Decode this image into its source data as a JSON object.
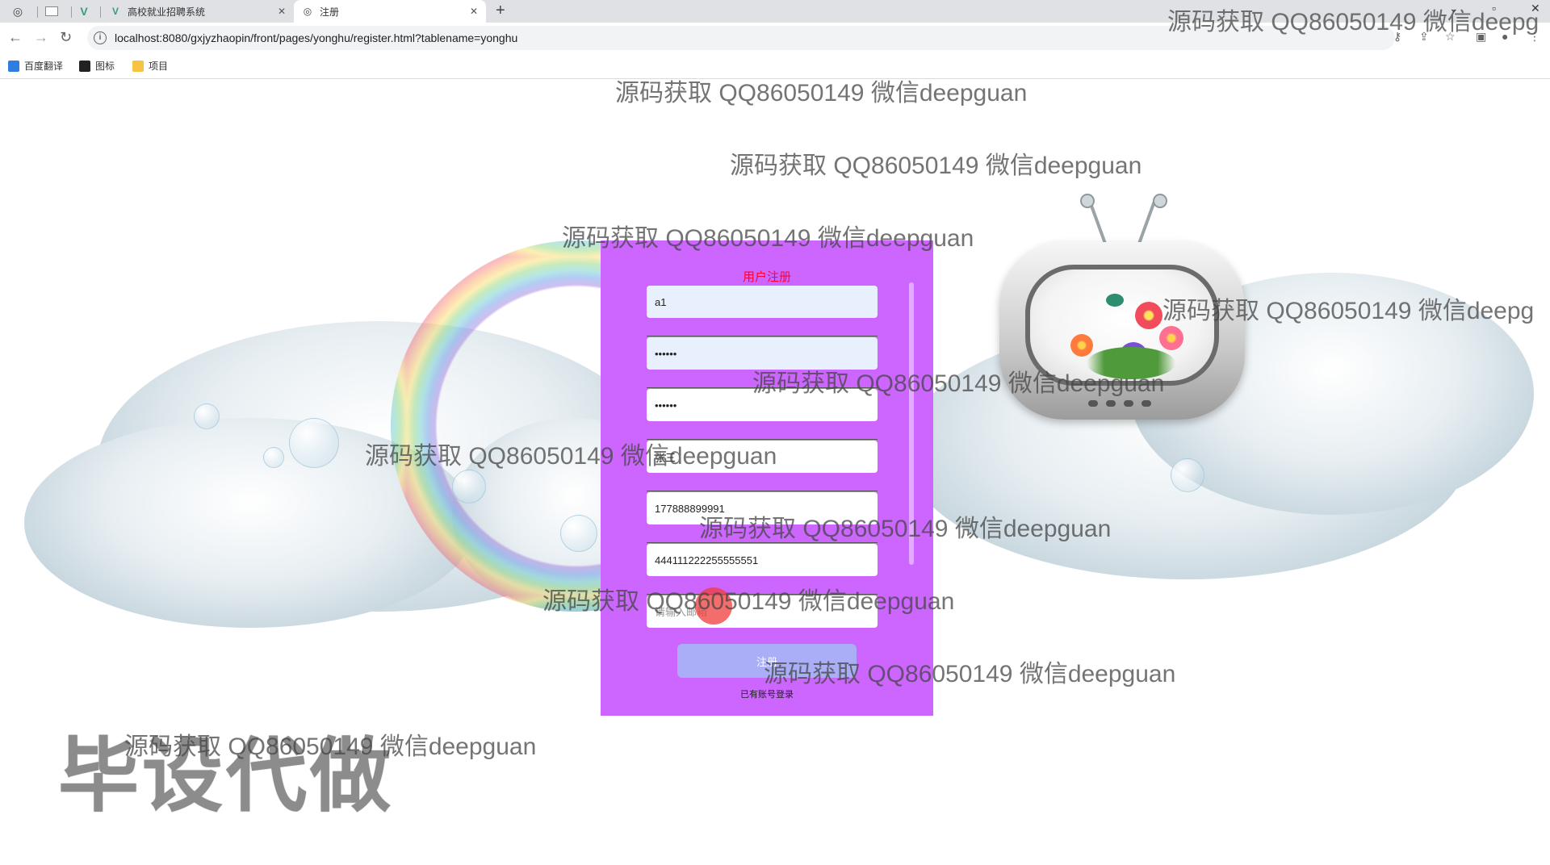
{
  "browser": {
    "tabs": [
      {
        "title": "高校就业招聘系统",
        "active": false
      },
      {
        "title": "注册",
        "active": true
      }
    ],
    "url": "localhost:8080/gxjyzhaopin/front/pages/yonghu/register.html?tablename=yonghu",
    "bookmarks": [
      "百度翻译",
      "图标",
      "项目"
    ]
  },
  "register": {
    "title": "用户注册",
    "fields": [
      {
        "value": "a1",
        "placeholder": ""
      },
      {
        "value": "••••••",
        "placeholder": ""
      },
      {
        "value": "••••••",
        "placeholder": ""
      },
      {
        "value": "张三",
        "placeholder": ""
      },
      {
        "value": "177888899991",
        "placeholder": ""
      },
      {
        "value": "444111222255555551",
        "placeholder": ""
      },
      {
        "value": "",
        "placeholder": "请输入邮箱"
      }
    ],
    "submit_label": "注册",
    "login_link": "已有账号登录"
  },
  "watermark": {
    "text": "源码获取 QQ86050149 微信deepguan",
    "clipped_text": "源码获取 QQ86050149 微信deepg",
    "big_text": "毕设代做"
  },
  "colors": {
    "panel_bg": "#cc66ff",
    "title_color": "#ff0033",
    "button_bg": "#a9aef7"
  }
}
